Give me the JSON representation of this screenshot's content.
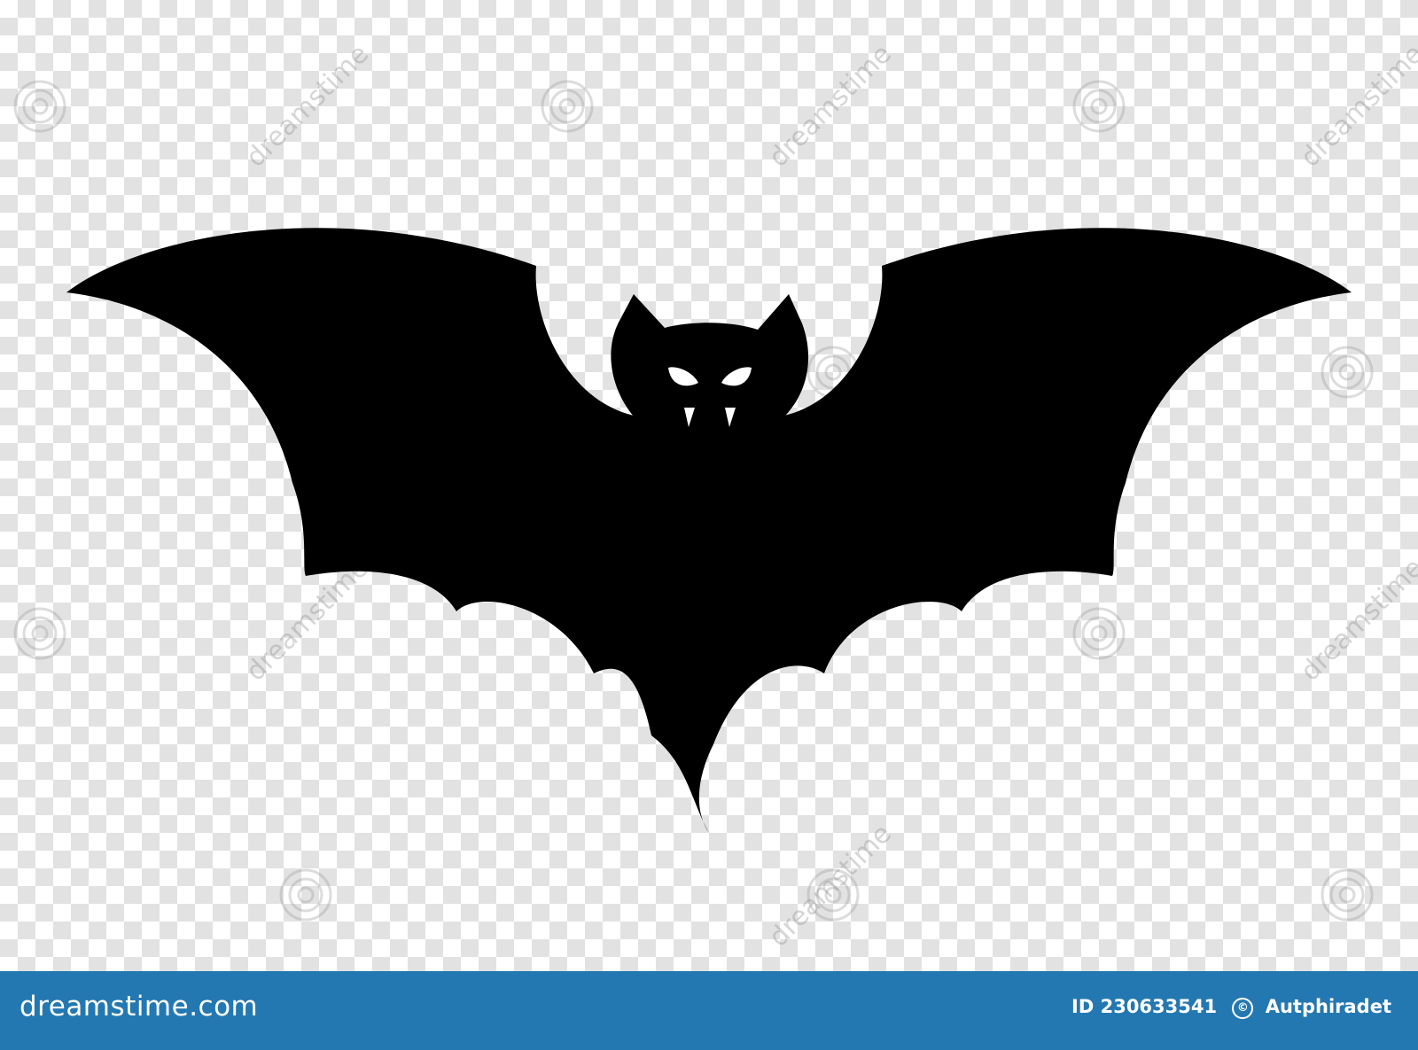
{
  "image": {
    "subject": "bat",
    "background": "transparent-checkerboard",
    "colors": {
      "checker_light": "#ffffff",
      "checker_dark": "#e2e2e2",
      "bat_fill": "#000000",
      "eyes_fangs": "#ffffff",
      "footer_bg": "#2478b1",
      "footer_text": "#ffffff"
    },
    "watermark_text": "dreamstime"
  },
  "footer": {
    "brand": "dreamstime.com",
    "id_label": "ID",
    "id_value": "230633541",
    "copyright_symbol": "©",
    "author": "Autphiradet"
  }
}
